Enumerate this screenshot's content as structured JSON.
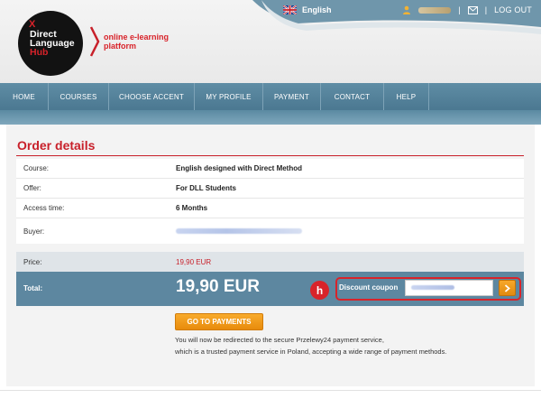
{
  "header": {
    "logo": {
      "mark": "X",
      "line1": "Direct",
      "line2": "Language",
      "line3": "Hub"
    },
    "tagline_line1": "online e-learning",
    "tagline_line2": "platform",
    "language": "English",
    "logout": "LOG OUT",
    "separator": "|"
  },
  "nav": {
    "items": [
      {
        "label": "HOME",
        "w": 54
      },
      {
        "label": "COURSES",
        "w": 67
      },
      {
        "label": "CHOOSE ACCENT",
        "w": 95
      },
      {
        "label": "MY PROFILE",
        "w": 76
      },
      {
        "label": "PAYMENT",
        "w": 64
      },
      {
        "label": "CONTACT",
        "w": 70
      },
      {
        "label": "HELP",
        "w": 50
      }
    ]
  },
  "order": {
    "title": "Order details",
    "course_label": "Course:",
    "course_value": "English designed with Direct Method",
    "offer_label": "Offer:",
    "offer_value": "For DLL Students",
    "access_label": "Access time:",
    "access_value": "6 Months",
    "buyer_label": "Buyer:",
    "price_label": "Price:",
    "price_value": "19,90 EUR",
    "total_label": "Total:",
    "total_value": "19,90 EUR",
    "badge": "h",
    "coupon_label": "Discount coupon",
    "go_button": "GO TO PAYMENTS",
    "note_line1": "You will now be redirected to the secure Przelewy24 payment service,",
    "note_line2": "which is a trusted payment service in Poland, accepting a wide range of payment methods."
  },
  "colors": {
    "accent_red": "#c8202a",
    "nav_blue": "#5f8da5",
    "button_orange": "#f9ab2c"
  },
  "icons": [
    "uk-flag-icon",
    "user-icon",
    "mail-icon",
    "chevron-right-icon"
  ]
}
